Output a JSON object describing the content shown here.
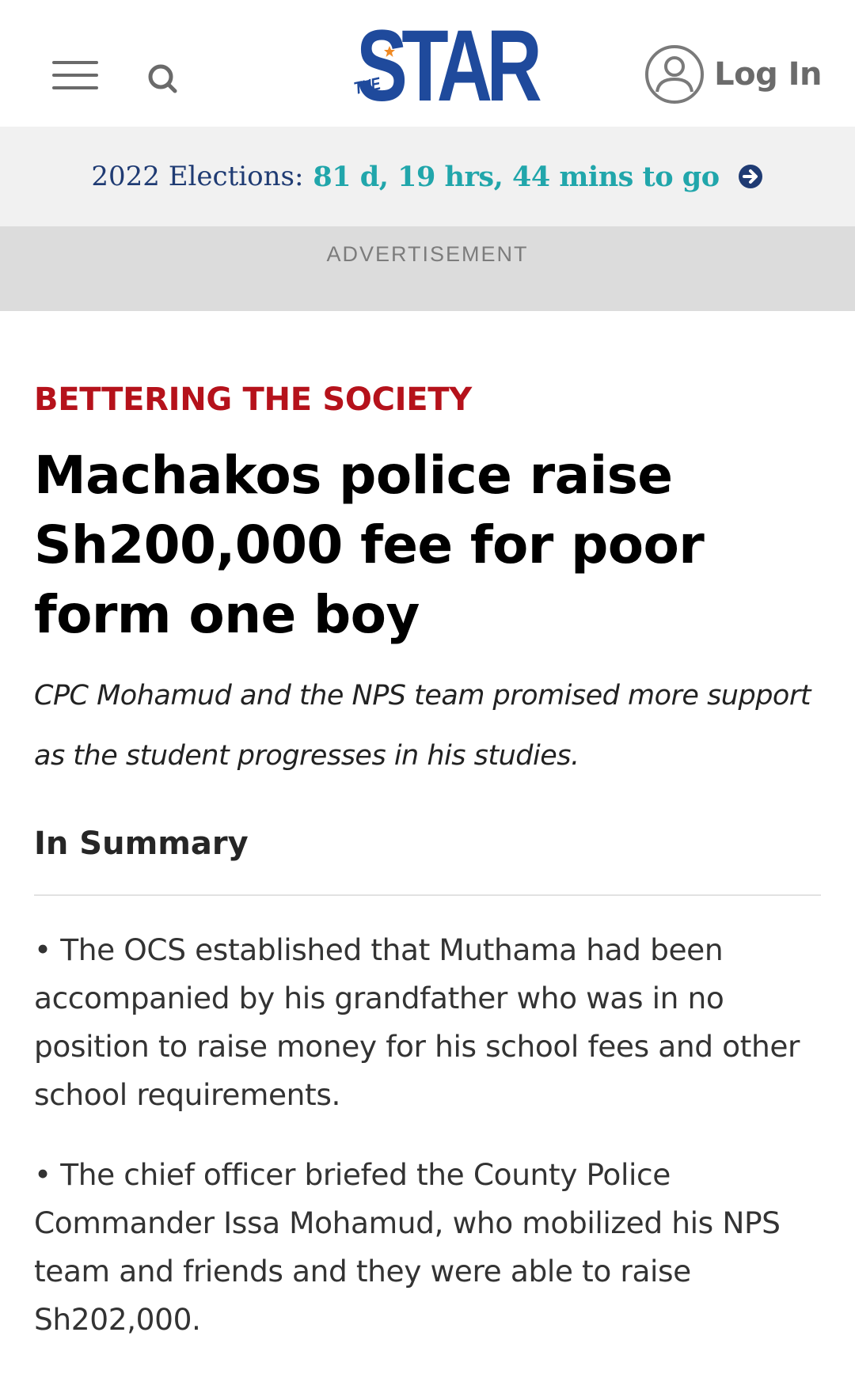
{
  "header": {
    "logo_prefix": "THE",
    "logo_text": "STAR",
    "login_label": "Log In",
    "brand_color": "#1f4a9c"
  },
  "election_banner": {
    "label": "2022 Elections:",
    "countdown": "81 d, 19 hrs, 44 mins to go"
  },
  "ad": {
    "label": "ADVERTISEMENT"
  },
  "article": {
    "category": "BETTERING THE SOCIETY",
    "headline": "Machakos police raise Sh200,000 fee for poor form one boy",
    "standfirst": "CPC Mohamud and the NPS team promised more support as the student progresses in his studies.",
    "summary_title": "In Summary",
    "summary_items": [
      "• The OCS established that Muthama had been accompanied by his grandfather who was in no position to raise money for his school fees and other school requirements.",
      "• The chief officer briefed the County Police Commander Issa Mohamud, who mobilized his NPS team and friends and they were able to raise Sh202,000."
    ]
  },
  "colors": {
    "category": "#b5121b",
    "countdown": "#21a6ab",
    "election_label": "#1f3b73"
  }
}
